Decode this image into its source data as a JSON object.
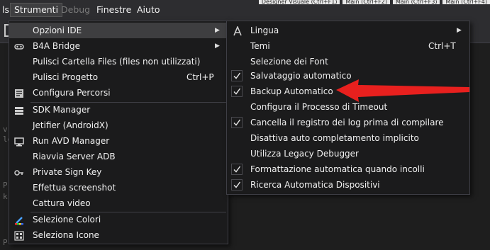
{
  "menubar": {
    "items": [
      {
        "label": "ls",
        "state": "normal"
      },
      {
        "label": "Strumenti",
        "state": "active"
      },
      {
        "label": "Debug",
        "state": "disabled"
      },
      {
        "label": "Finestre",
        "state": "normal"
      },
      {
        "label": "Aiuto",
        "state": "normal"
      }
    ],
    "top_tabs": [
      "Designer Visuale  (Ctrl+F1)",
      "Main  (Ctrl+F2)",
      "Main  (Ctrl+F3)",
      "Main  (Ctrl+F4)"
    ]
  },
  "strumenti_menu": {
    "items": [
      {
        "label": "Opzioni IDE",
        "icon": "none",
        "has_submenu": true,
        "highlighted": true
      },
      {
        "label": "B4A Bridge",
        "icon": "bridge-icon",
        "has_submenu": true
      },
      {
        "label": "Pulisci Cartella Files (files non utilizzati)",
        "icon": "none"
      },
      {
        "label": "Pulisci Progetto",
        "icon": "none",
        "shortcut": "Ctrl+P"
      },
      {
        "label": "Configura Percorsi",
        "icon": "configure-paths-icon"
      },
      {
        "label": "SDK Manager",
        "icon": "sdk-manager-icon"
      },
      {
        "label": "Jetifier (AndroidX)",
        "icon": "none"
      },
      {
        "label": "Run AVD Manager",
        "icon": "avd-manager-icon"
      },
      {
        "label": "Riavvia Server ADB",
        "icon": "none"
      },
      {
        "label": "Private Sign Key",
        "icon": "key-icon"
      },
      {
        "label": "Effettua screenshot",
        "icon": "none"
      },
      {
        "label": "Cattura video",
        "icon": "none"
      },
      {
        "label": "Selezione Colori",
        "icon": "color-picker-icon"
      },
      {
        "label": "Seleziona Icone",
        "icon": "icon-grid-icon"
      }
    ]
  },
  "opzioni_submenu": {
    "items": [
      {
        "label": "Lingua",
        "icon": "font-icon",
        "has_submenu": true
      },
      {
        "label": "Temi",
        "shortcut": "Ctrl+T"
      },
      {
        "label": "Selezione dei Font"
      },
      {
        "label": "Salvataggio automatico",
        "checked": true
      },
      {
        "label": "Backup Automatico",
        "checked": true
      },
      {
        "label": "Configura il Processo di Timeout"
      },
      {
        "label": "Cancella il registro dei log prima di compilare",
        "checked": true
      },
      {
        "label": "Disattiva auto completamento implicito"
      },
      {
        "label": "Utilizza Legacy Debugger"
      },
      {
        "label": "Formattazione automatica quando incolli",
        "checked": true
      },
      {
        "label": "Ricerca Automatica Dispositivi",
        "checked": true
      }
    ]
  },
  "annotation": {
    "color": "#e8201e",
    "points_to": "Backup Automatico"
  },
  "colors": {
    "menu_bg": "#1b1b1c",
    "highlight": "#3e3e40",
    "border": "#3f3f46"
  }
}
